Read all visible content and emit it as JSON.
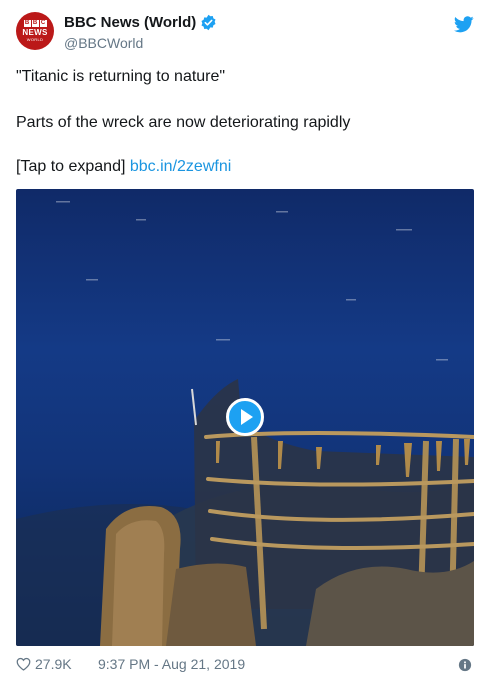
{
  "header": {
    "avatar": {
      "blocks": [
        "B",
        "B",
        "C"
      ],
      "news": "NEWS",
      "world": "WORLD"
    },
    "display_name": "BBC News (World)",
    "handle": "@BBCWorld",
    "verified_icon": "verified-badge-icon",
    "brand_icon": "twitter-bird-icon"
  },
  "tweet": {
    "line1": "\"Titanic is returning to nature\"",
    "line2": "Parts of the wreck are now deteriorating rapidly",
    "expand_label": "[Tap to expand]",
    "link": "bbc.in/2zewfni"
  },
  "media": {
    "type": "video",
    "play_icon": "play-button-icon"
  },
  "footer": {
    "like_count": "27.9K",
    "timestamp": "9:37 PM - Aug 21, 2019",
    "info_icon": "info-icon"
  },
  "colors": {
    "accent": "#1da1f2",
    "link": "#1b95e0",
    "secondary": "#657786",
    "bbc_red": "#bb1919"
  }
}
